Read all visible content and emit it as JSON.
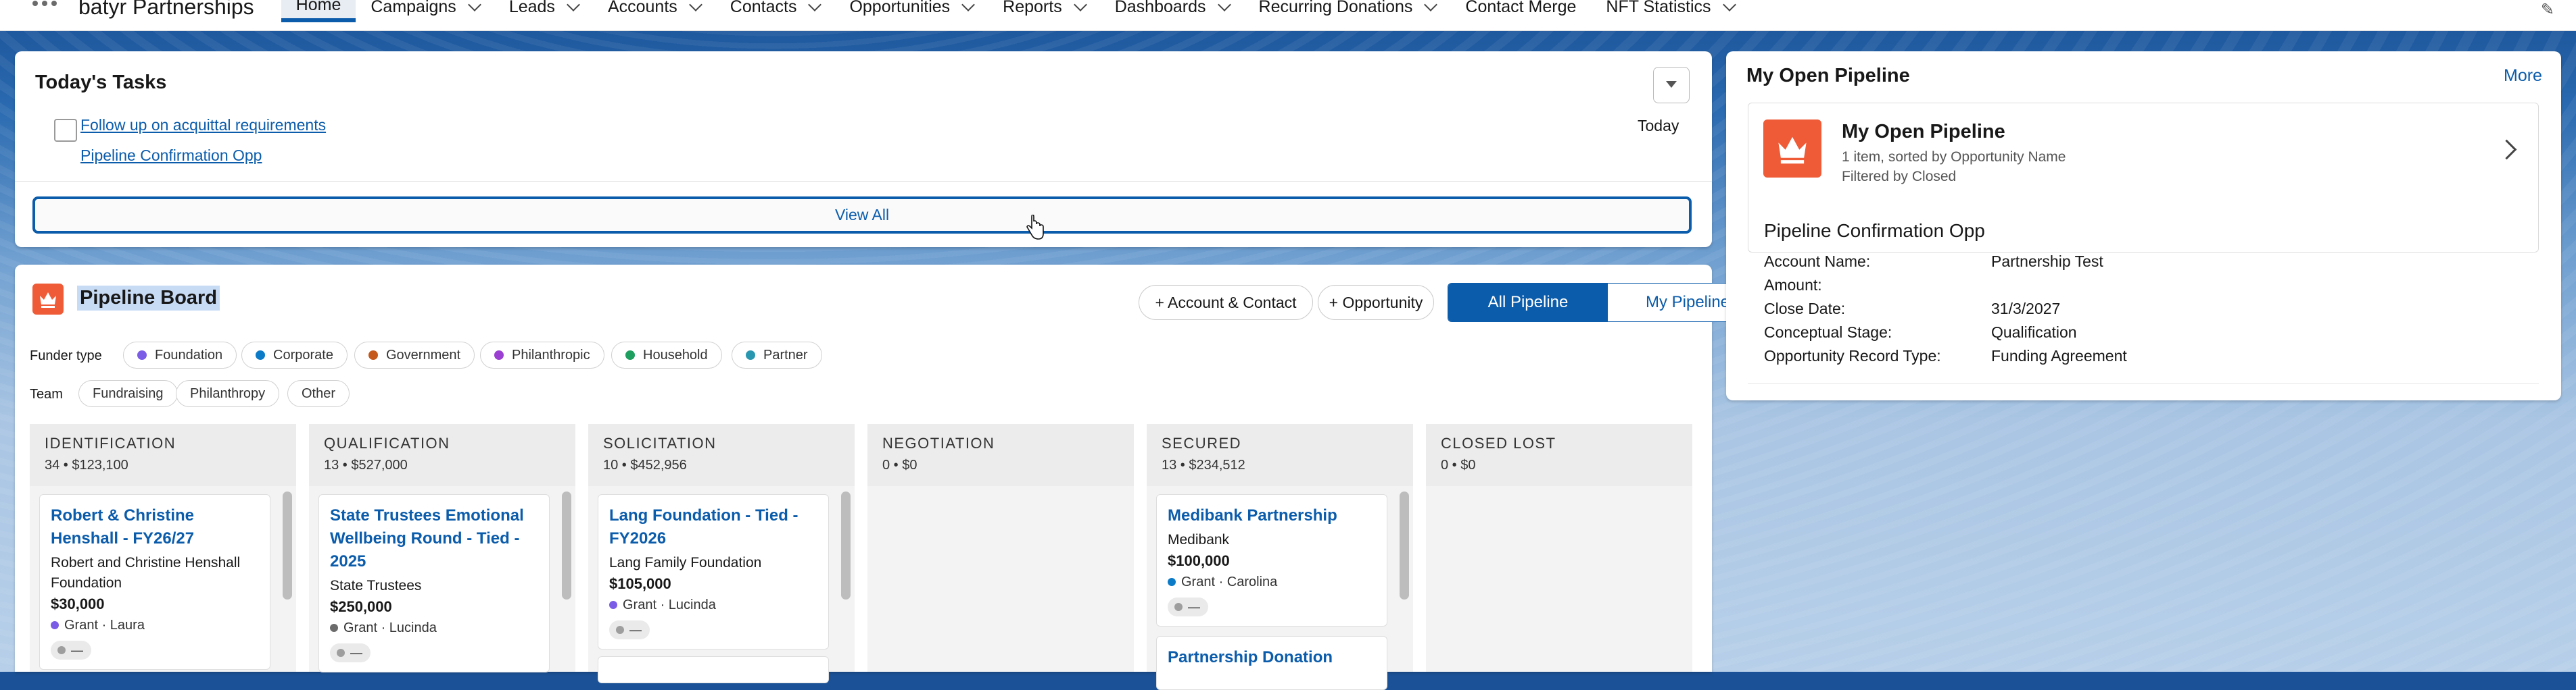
{
  "app": {
    "name": "batyr Partnerships"
  },
  "nav": [
    {
      "label": "Home",
      "active": true,
      "menu": false
    },
    {
      "label": "Campaigns",
      "menu": true
    },
    {
      "label": "Leads",
      "menu": true
    },
    {
      "label": "Accounts",
      "menu": true
    },
    {
      "label": "Contacts",
      "menu": true
    },
    {
      "label": "Opportunities",
      "menu": true
    },
    {
      "label": "Reports",
      "menu": true
    },
    {
      "label": "Dashboards",
      "menu": true
    },
    {
      "label": "Recurring Donations",
      "menu": true
    },
    {
      "label": "Contact Merge",
      "menu": false
    },
    {
      "label": "NFT Statistics",
      "menu": true
    }
  ],
  "tasks": {
    "title": "Today's Tasks",
    "item": {
      "subject": "Follow up on acquittal requirements",
      "related": "Pipeline Confirmation Opp",
      "due": "Today"
    },
    "view_all": "View All"
  },
  "board": {
    "title": "Pipeline Board",
    "add_account": "+ Account & Contact",
    "add_opp": "+ Opportunity",
    "all_pipeline": "All Pipeline",
    "my_pipeline": "My Pipeline",
    "funder_label": "Funder type",
    "funder_types": [
      {
        "label": "Foundation",
        "color": "#7b5ce6"
      },
      {
        "label": "Corporate",
        "color": "#0b7ac7"
      },
      {
        "label": "Government",
        "color": "#c5591b"
      },
      {
        "label": "Philanthropic",
        "color": "#9a3fd1"
      },
      {
        "label": "Household",
        "color": "#1e9e5f"
      },
      {
        "label": "Partner",
        "color": "#2a97b0"
      }
    ],
    "team_label": "Team",
    "teams": [
      "Fundraising",
      "Philanthropy",
      "Other"
    ],
    "columns": [
      {
        "name": "IDENTIFICATION",
        "summary": "34 • $123,100",
        "cards": [
          {
            "title": "Robert & Christine Henshall - FY26/27",
            "org": "Robert and Christine Henshall Foundation",
            "amount": "$30,000",
            "meta": "Grant · Laura",
            "dot": "#7b5ce6",
            "pill": "—"
          }
        ]
      },
      {
        "name": "QUALIFICATION",
        "summary": "13 • $527,000",
        "cards": [
          {
            "title": "State Trustees Emotional Wellbeing Round - Tied - 2025",
            "org": "State Trustees",
            "amount": "$250,000",
            "meta": "Grant · Lucinda",
            "dot": "#6b6b6b",
            "pill": "—"
          }
        ]
      },
      {
        "name": "SOLICITATION",
        "summary": "10 • $452,956",
        "cards": [
          {
            "title": "Lang Foundation - Tied - FY2026",
            "org": "Lang Family Foundation",
            "amount": "$105,000",
            "meta": "Grant · Lucinda",
            "dot": "#7b5ce6",
            "pill": "—"
          }
        ]
      },
      {
        "name": "NEGOTIATION",
        "summary": "0 • $0",
        "cards": []
      },
      {
        "name": "SECURED",
        "summary": "13 • $234,512",
        "cards": [
          {
            "title": "Medibank Partnership",
            "org": "Medibank",
            "amount": "$100,000",
            "meta": "Grant · Carolina",
            "dot": "#0b7ac7",
            "pill": "—"
          },
          {
            "title": "Partnership Donation"
          }
        ]
      },
      {
        "name": "CLOSED LOST",
        "summary": "0 • $0",
        "cards": []
      }
    ]
  },
  "pipeline_panel": {
    "title": "My Open Pipeline",
    "more": "More",
    "list_title": "My Open Pipeline",
    "list_sub": "1 item, sorted by Opportunity Name",
    "list_filter": "Filtered by Closed",
    "record": {
      "name": "Pipeline Confirmation Opp",
      "fields": [
        {
          "label": "Account Name:",
          "value": "Partnership Test"
        },
        {
          "label": "Amount:",
          "value": ""
        },
        {
          "label": "Close Date:",
          "value": "31/3/2027"
        },
        {
          "label": "Conceptual Stage:",
          "value": "Qualification"
        },
        {
          "label": "Opportunity Record Type:",
          "value": "Funding Agreement"
        }
      ]
    }
  }
}
